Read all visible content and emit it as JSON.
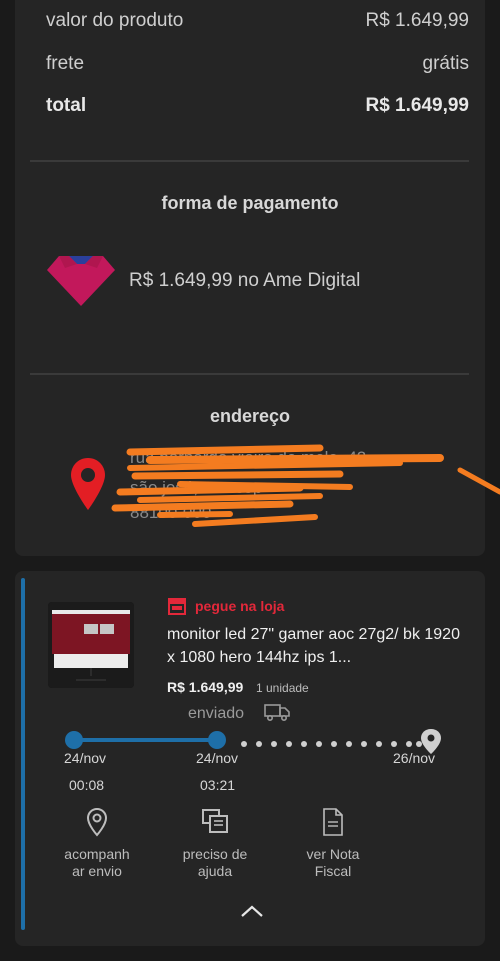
{
  "summary": {
    "product_value_label": "valor do produto",
    "product_value": "R$ 1.649,99",
    "shipping_label": "frete",
    "shipping_value": "grátis",
    "total_label": "total",
    "total_value": "R$ 1.649,99"
  },
  "payment": {
    "title": "forma de pagamento",
    "text": "R$ 1.649,99 no Ame Digital"
  },
  "address": {
    "title": "endereço",
    "line1": "rua bernardo vieira de melo, 42",
    "line2": "são josé, sc - cep",
    "line3": "88100-000"
  },
  "order": {
    "delivery_type": "pegue na loja",
    "product_title": "monitor led 27\" gamer aoc 27g2/ bk 1920 x 1080 hero 144hz ips 1...",
    "price": "R$ 1.649,99",
    "quantity": "1 unidade",
    "status": "enviado",
    "timeline": [
      {
        "date": "24/nov",
        "time": "00:08"
      },
      {
        "date": "24/nov",
        "time": "03:21"
      },
      {
        "date": "26/nov",
        "time": ""
      }
    ],
    "actions": {
      "track": "acompanhar envio",
      "help": "preciso de ajuda",
      "invoice": "ver Nota Fiscal"
    }
  },
  "colors": {
    "accent_blue": "#1e6fa8",
    "store_red": "#e3283a",
    "ame_pink": "#c2185b",
    "pin_red": "#e31e24",
    "scribble_orange": "#f47c20"
  }
}
